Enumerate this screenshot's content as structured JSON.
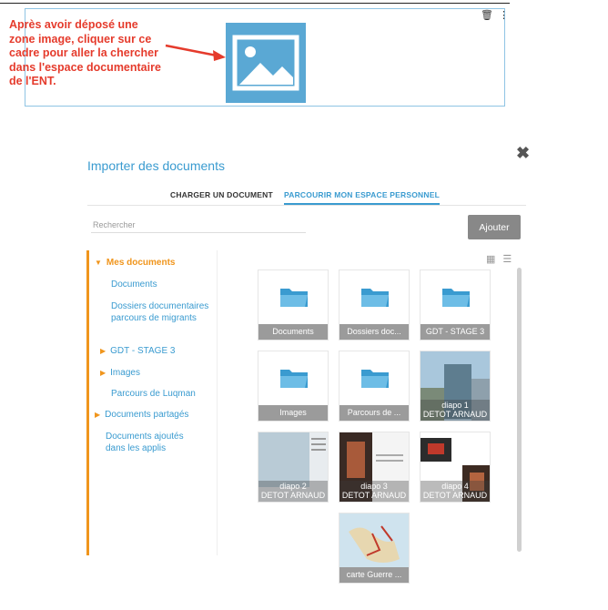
{
  "annotation": {
    "text": "Après avoir déposé une zone image, cliquer sur ce cadre pour aller la chercher dans l'espace documentaire de l'ENT.",
    "color": "#e53b2c"
  },
  "image_zone": {
    "placeholder_icon": "image-placeholder-icon",
    "tools": [
      "trash-icon",
      "more-vertical-icon"
    ]
  },
  "dialog": {
    "title": "Importer des documents",
    "tabs": [
      {
        "label": "CHARGER UN DOCUMENT",
        "active": false
      },
      {
        "label": "PARCOURIR MON ESPACE PERSONNEL",
        "active": true
      }
    ],
    "search_placeholder": "Rechercher",
    "add_button": "Ajouter",
    "close_icon": "close-icon"
  },
  "sidebar": {
    "items": [
      {
        "label": "Mes documents",
        "selected": true,
        "expandable": true
      },
      {
        "label": "Documents"
      },
      {
        "label": "Dossiers documentaires parcours de migrants"
      },
      {
        "label": "GDT - STAGE 3",
        "expandable": true
      },
      {
        "label": "Images",
        "expandable": true
      },
      {
        "label": "Parcours de Luqman"
      },
      {
        "label": "Documents partagés",
        "expandable": true
      },
      {
        "label": "Documents ajoutés dans les applis"
      }
    ]
  },
  "view_toggle": [
    "grid-view-icon",
    "list-view-icon"
  ],
  "files": [
    {
      "type": "folder",
      "label": "Documents"
    },
    {
      "type": "folder",
      "label": "Dossiers doc..."
    },
    {
      "type": "folder",
      "label": "GDT - STAGE 3"
    },
    {
      "type": "folder",
      "label": "Images"
    },
    {
      "type": "folder",
      "label": "Parcours de ..."
    },
    {
      "type": "image",
      "label": "diapo 1",
      "owner": "DETOT ARNAUD"
    },
    {
      "type": "image",
      "label": "diapo 2",
      "owner": "DETOT ARNAUD"
    },
    {
      "type": "image",
      "label": "diapo 3",
      "owner": "DETOT ARNAUD"
    },
    {
      "type": "image",
      "label": "diapo 4",
      "owner": "DETOT ARNAUD"
    },
    {
      "type": "image",
      "label": "carte Guerre ..."
    }
  ],
  "colors": {
    "accent": "#3a9bd0",
    "tree_active": "#f0951c",
    "tile_caption": "#9b9b9b"
  }
}
